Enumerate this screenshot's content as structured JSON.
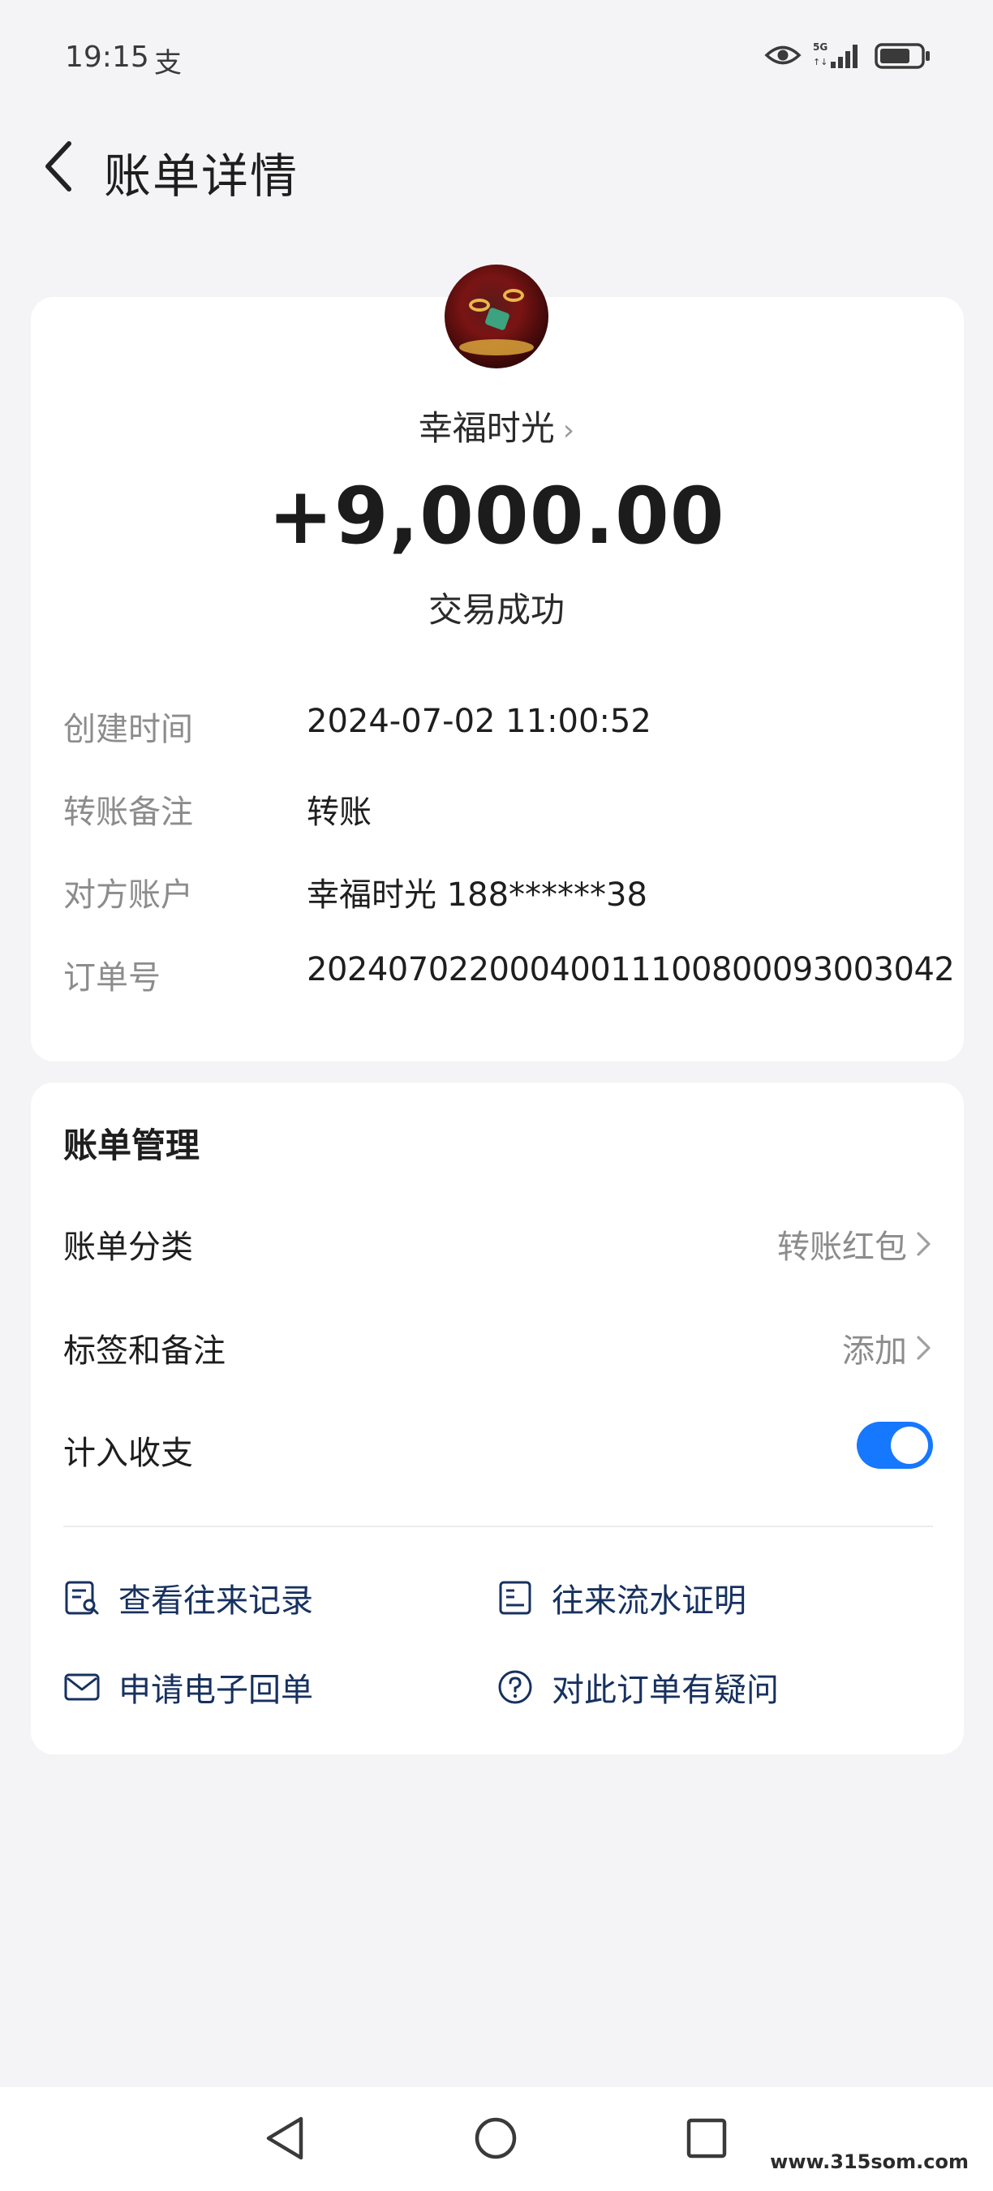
{
  "status_bar": {
    "time": "19:15",
    "app_glyph": "支",
    "network": "5G"
  },
  "header": {
    "title": "账单详情"
  },
  "transaction": {
    "payee": "幸福时光",
    "amount": "+9,000.00",
    "status": "交易成功"
  },
  "details": [
    {
      "label": "创建时间",
      "value": "2024-07-02 11:00:52"
    },
    {
      "label": "转账备注",
      "value": "转账"
    },
    {
      "label": "对方账户",
      "value": "幸福时光 188******38"
    },
    {
      "label": "订单号",
      "value": "2024070220004001110080009300​3042"
    }
  ],
  "manage": {
    "title": "账单管理",
    "category_label": "账单分类",
    "category_value": "转账红包",
    "tags_label": "标签和备注",
    "tags_value": "添加",
    "count_label": "计入收支",
    "count_enabled": true
  },
  "actions": {
    "view_records": "查看往来记录",
    "flow_proof": "往来流水证明",
    "e_receipt": "申请电子回单",
    "question": "对此订单有疑问"
  },
  "watermark": "www.315som.com",
  "colors": {
    "background": "#f4f4f6",
    "card": "#ffffff",
    "toggle_on": "#1677ff",
    "action_text": "#17315f",
    "secondary_text": "#8c8c8c"
  }
}
